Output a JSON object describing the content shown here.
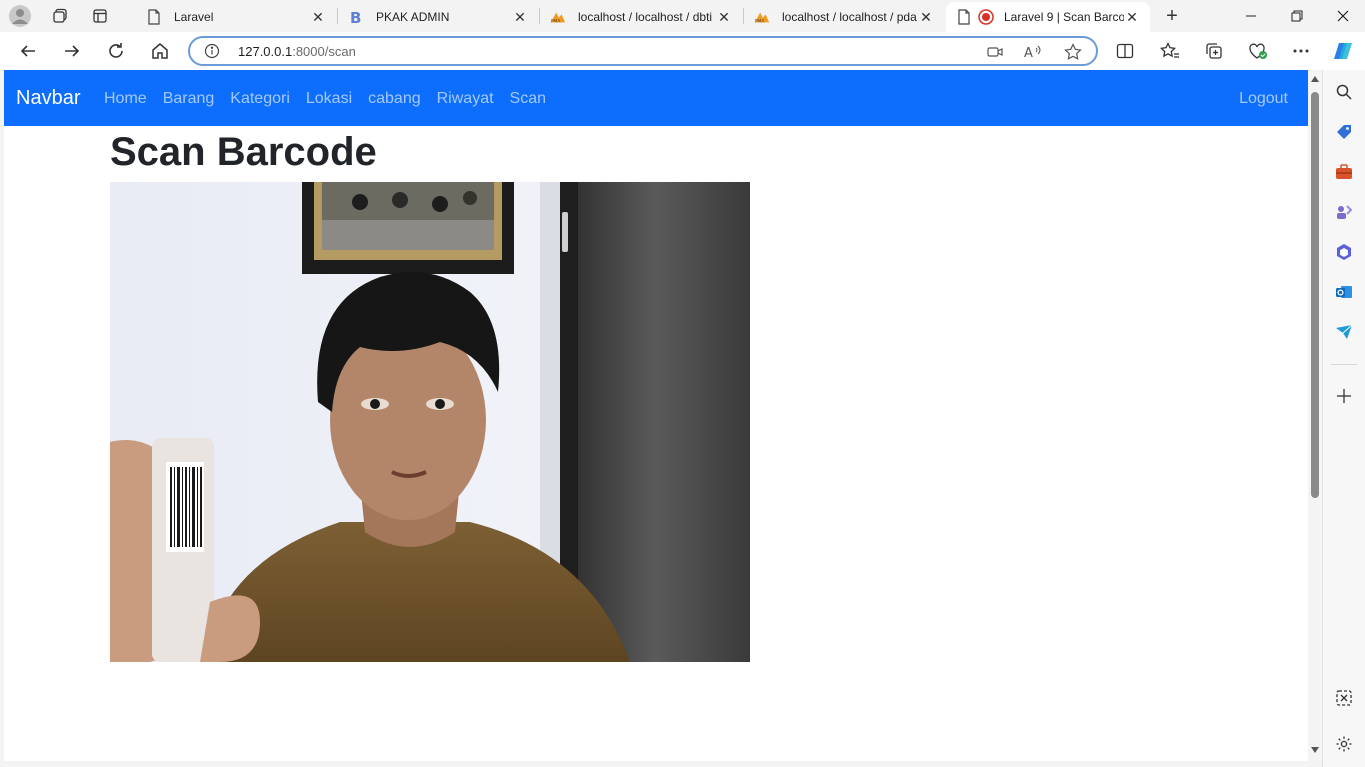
{
  "browser": {
    "tabs": [
      {
        "title": "Laravel",
        "favicon": "page-icon"
      },
      {
        "title": "PKAK ADMIN",
        "favicon": "bootstrap-b-icon"
      },
      {
        "title": "localhost / localhost / dbti",
        "favicon": "phpmyadmin-icon"
      },
      {
        "title": "localhost / localhost / pda",
        "favicon": "phpmyadmin-icon"
      },
      {
        "title": "Laravel 9 | Scan Barco",
        "favicon": "page-icon",
        "active": true
      }
    ],
    "address": {
      "host": "127.0.0.1",
      "path": ":8000/scan"
    }
  },
  "app": {
    "brand": "Navbar",
    "nav": [
      "Home",
      "Barang",
      "Kategori",
      "Lokasi",
      "cabang",
      "Riwayat",
      "Scan"
    ],
    "logout": "Logout",
    "title": "Scan Barcode",
    "camera_label": "webcam-preview"
  },
  "colors": {
    "navbar": "#0d6efd",
    "recording": "#d93025"
  }
}
